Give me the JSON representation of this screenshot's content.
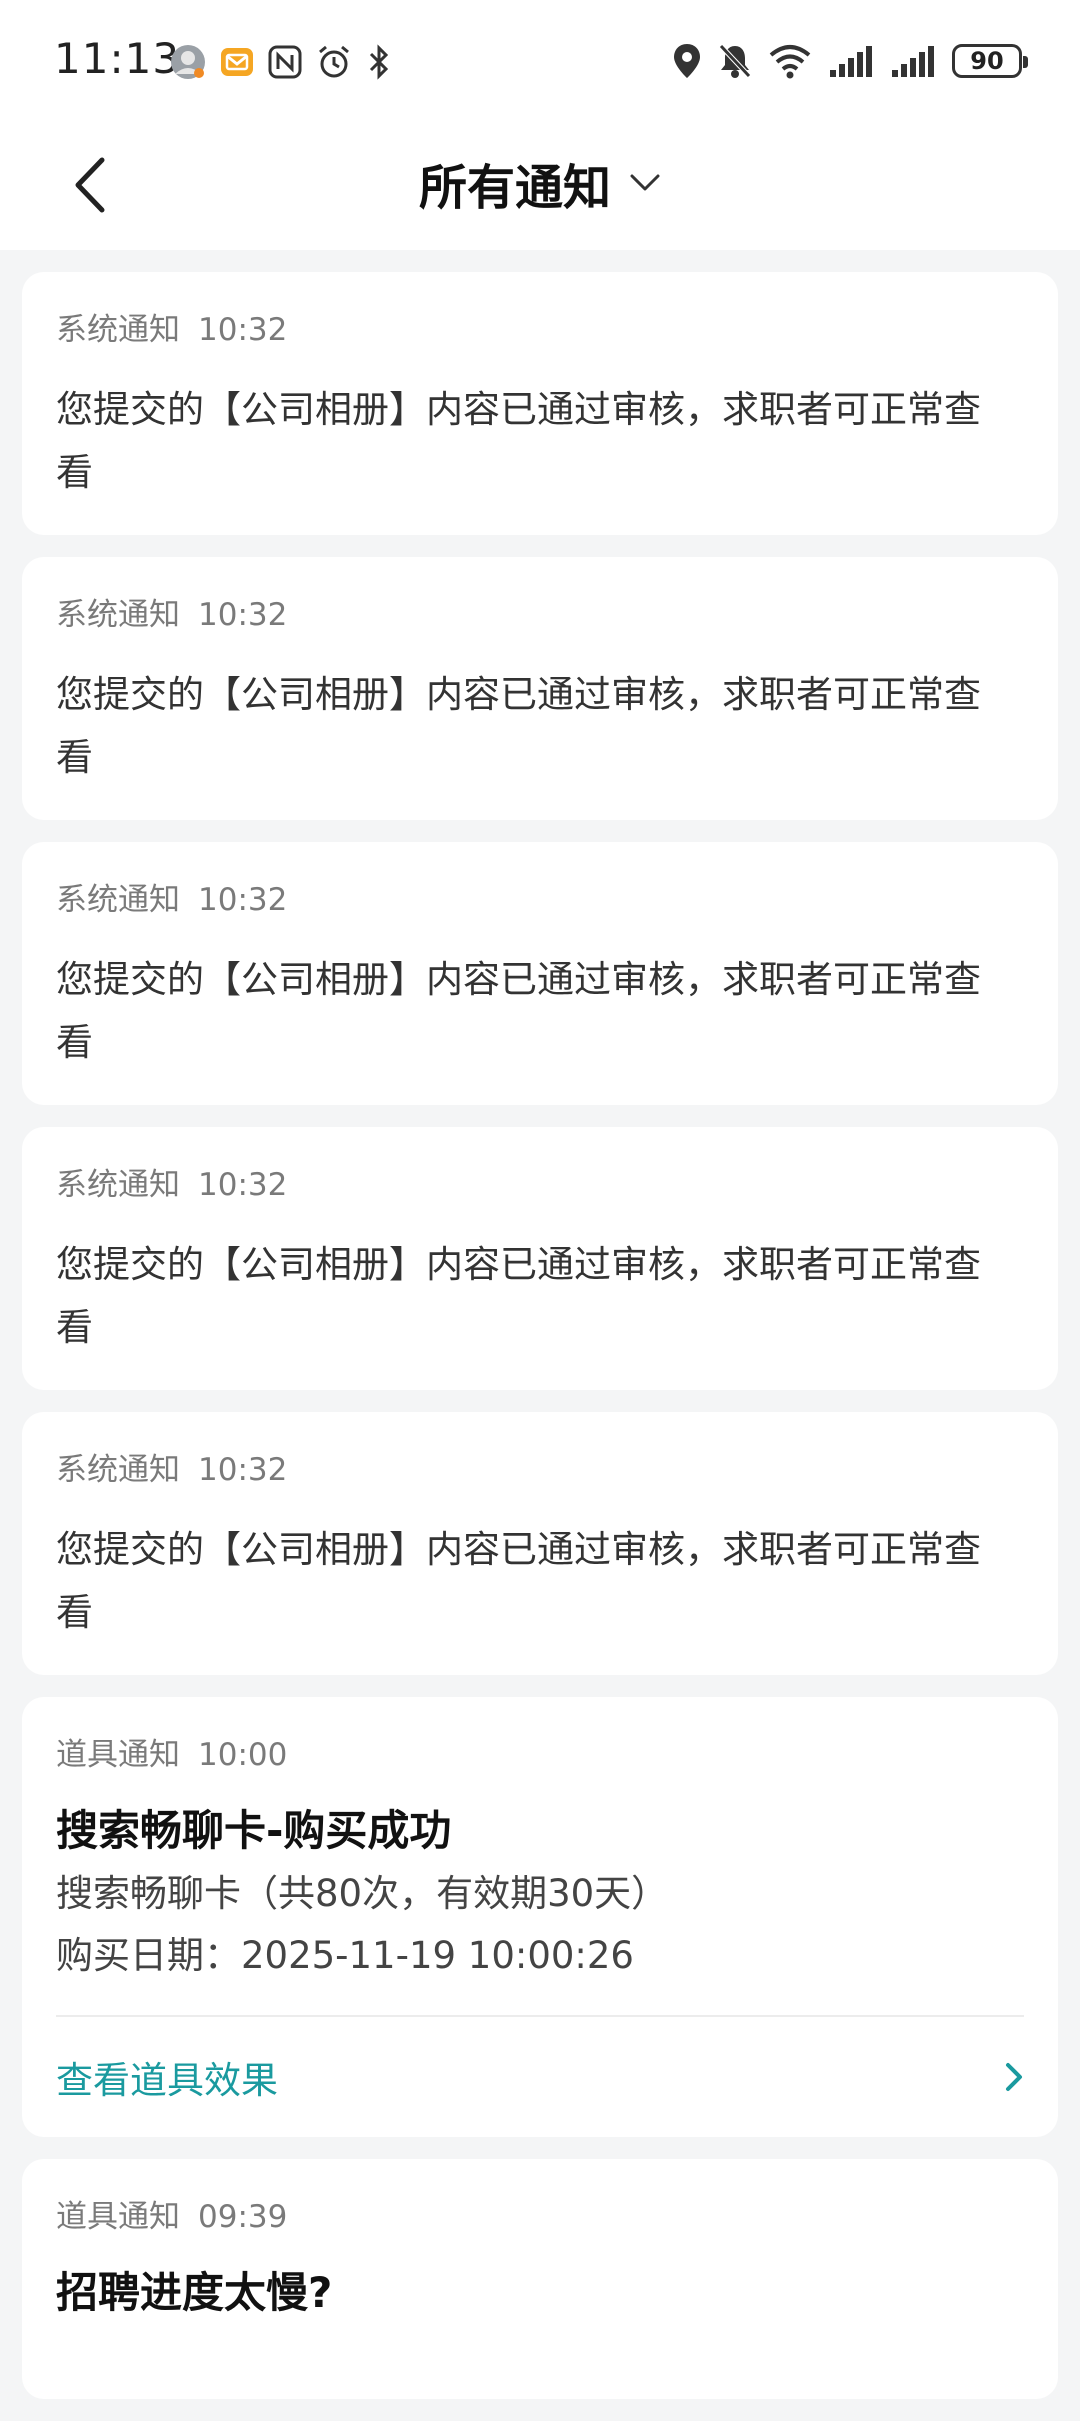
{
  "status_bar": {
    "time": "11:13",
    "battery": "90",
    "left_icons": [
      "avatar-icon",
      "mail-icon",
      "nfc-icon",
      "alarm-icon",
      "bluetooth-icon"
    ],
    "right_icons": [
      "location-icon",
      "mute-icon",
      "wifi-icon",
      "signal-icon",
      "signal-icon"
    ]
  },
  "header": {
    "title": "所有通知",
    "accent_color": "#1a9a9f"
  },
  "notifications": [
    {
      "type": "系统通知",
      "time": "10:32",
      "text": "您提交的【公司相册】内容已通过审核，求职者可正常查看"
    },
    {
      "type": "系统通知",
      "time": "10:32",
      "text": "您提交的【公司相册】内容已通过审核，求职者可正常查看"
    },
    {
      "type": "系统通知",
      "time": "10:32",
      "text": "您提交的【公司相册】内容已通过审核，求职者可正常查看"
    },
    {
      "type": "系统通知",
      "time": "10:32",
      "text": "您提交的【公司相册】内容已通过审核，求职者可正常查看"
    },
    {
      "type": "系统通知",
      "time": "10:32",
      "text": "您提交的【公司相册】内容已通过审核，求职者可正常查看"
    }
  ],
  "prop_notification": {
    "type": "道具通知",
    "time": "10:00",
    "title": "搜索畅聊卡-购买成功",
    "line1": "搜索畅聊卡（共80次，有效期30天）",
    "line2": "购买日期：2025-11-19 10:00:26",
    "action": "查看道具效果"
  },
  "prop_notification_2": {
    "type": "道具通知",
    "time": "09:39",
    "title": "招聘进度太慢?"
  }
}
